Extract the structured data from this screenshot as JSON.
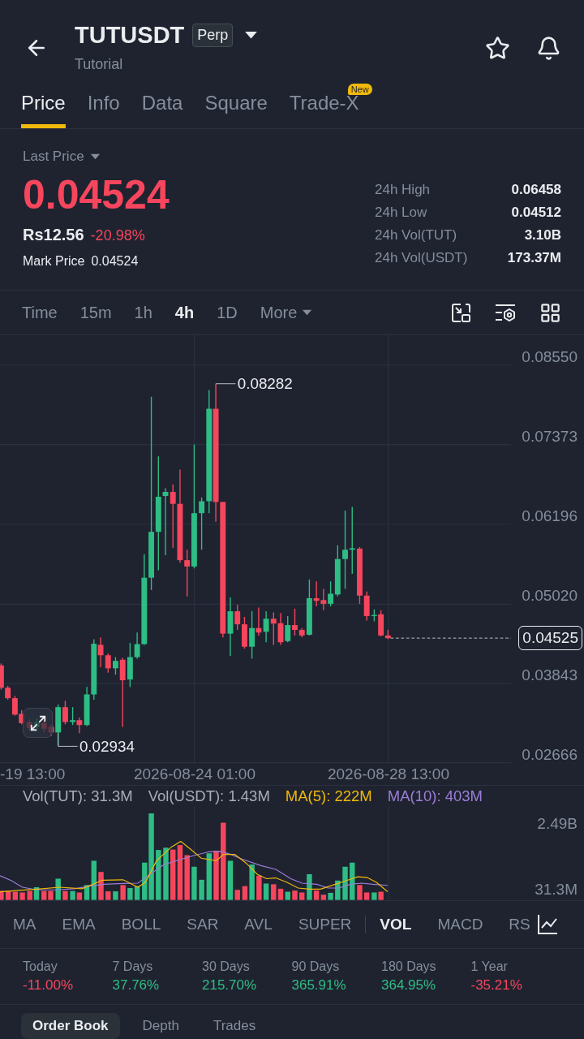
{
  "header": {
    "title": "TUTUSDT",
    "badge": "Perp",
    "subtitle": "Tutorial"
  },
  "tabs": [
    {
      "label": "Price",
      "selected": true
    },
    {
      "label": "Info",
      "selected": false
    },
    {
      "label": "Data",
      "selected": false
    },
    {
      "label": "Square",
      "selected": false
    },
    {
      "label": "Trade-X",
      "selected": false,
      "badge": "New"
    }
  ],
  "summary": {
    "selector": "Last Price",
    "last_price": "0.04524",
    "fiat_price": "Rs12.56",
    "change": "-20.98%",
    "mark_price_label": "Mark Price",
    "mark_price": "0.04524",
    "stats": [
      {
        "label": "24h High",
        "value": "0.06458"
      },
      {
        "label": "24h Low",
        "value": "0.04512"
      },
      {
        "label": "24h Vol(TUT)",
        "value": "3.10B"
      },
      {
        "label": "24h Vol(USDT)",
        "value": "173.37M"
      }
    ]
  },
  "intervals": [
    {
      "label": "Time",
      "kind": "option",
      "selected": false
    },
    {
      "label": "15m",
      "kind": "option",
      "selected": false
    },
    {
      "label": "1h",
      "kind": "option",
      "selected": false
    },
    {
      "label": "4h",
      "kind": "option",
      "selected": true
    },
    {
      "label": "1D",
      "kind": "option",
      "selected": false
    },
    {
      "label": "More",
      "kind": "menu",
      "selected": false
    }
  ],
  "chart": {
    "price_labels": [
      "0.08550",
      "0.07373",
      "0.06196",
      "0.05020",
      "0.03843",
      "0.02666"
    ],
    "high_label": "0.08282",
    "low_label": "0.02934",
    "current_price": "0.04525",
    "time_labels": [
      "-19 13:00",
      "2026-08-24 01:00",
      "2026-08-28 13:00"
    ]
  },
  "volume": {
    "legend": [
      {
        "text": "Vol(TUT): 31.3M",
        "color": "#a7aeb8"
      },
      {
        "text": "Vol(USDT): 1.43M",
        "color": "#a7aeb8"
      },
      {
        "text": "MA(5): 222M",
        "color": "#f0b90b"
      },
      {
        "text": "MA(10): 403M",
        "color": "#9c7ed8"
      }
    ],
    "axis_labels": [
      "2.49B",
      "31.3M"
    ]
  },
  "main_indicators": [
    {
      "label": "MA",
      "selected": false
    },
    {
      "label": "EMA",
      "selected": false
    },
    {
      "label": "BOLL",
      "selected": false
    },
    {
      "label": "SAR",
      "selected": false
    },
    {
      "label": "AVL",
      "selected": false
    },
    {
      "label": "SUPER",
      "selected": false
    }
  ],
  "sub_indicators": [
    {
      "label": "VOL",
      "selected": true
    },
    {
      "label": "MACD",
      "selected": false
    },
    {
      "label": "RS",
      "selected": false
    }
  ],
  "performance": [
    {
      "period": "Today",
      "change": "-11.00%",
      "color": "#f6465d"
    },
    {
      "period": "7 Days",
      "change": "37.76%",
      "color": "#2ebd85"
    },
    {
      "period": "30 Days",
      "change": "215.70%",
      "color": "#2ebd85"
    },
    {
      "period": "90 Days",
      "change": "365.91%",
      "color": "#2ebd85"
    },
    {
      "period": "180 Days",
      "change": "364.95%",
      "color": "#2ebd85"
    },
    {
      "period": "1 Year",
      "change": "-35.21%",
      "color": "#f6465d"
    }
  ],
  "book_tabs": [
    {
      "label": "Order Book",
      "selected": true
    },
    {
      "label": "Depth",
      "selected": false
    },
    {
      "label": "Trades",
      "selected": false
    }
  ]
}
